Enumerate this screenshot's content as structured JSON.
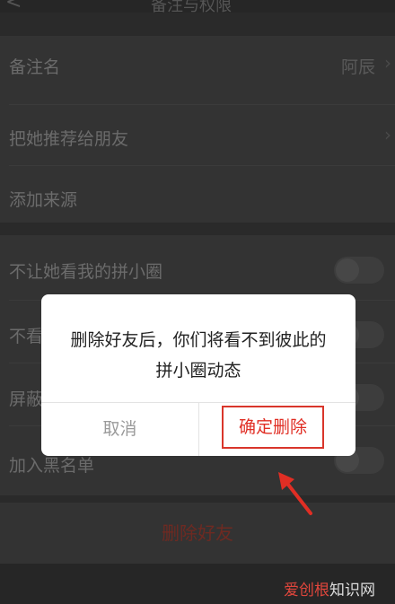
{
  "header": {
    "title": "备注与权限",
    "back_label": "<"
  },
  "settings": {
    "remark_label": "备注名",
    "remark_value": "阿辰",
    "recommend_label": "把她推荐给朋友",
    "source_label": "添加来源",
    "hide_my_circle_label": "不让她看我的拼小圈",
    "hide_her_circle_label": "不看",
    "block_label": "屏蔽",
    "blacklist_label": "加入黑名单",
    "delete_friend_label": "删除好友"
  },
  "dialog": {
    "message": "删除好友后，你们将看不到彼此的拼小圈动态",
    "cancel_label": "取消",
    "confirm_label": "确定删除"
  },
  "watermark": {
    "red_part": "爱创根",
    "rest": "知识网"
  },
  "colors": {
    "accent": "#e02e24",
    "dialog_bg": "#ffffff",
    "overlay_bg": "#2a2a2a"
  }
}
